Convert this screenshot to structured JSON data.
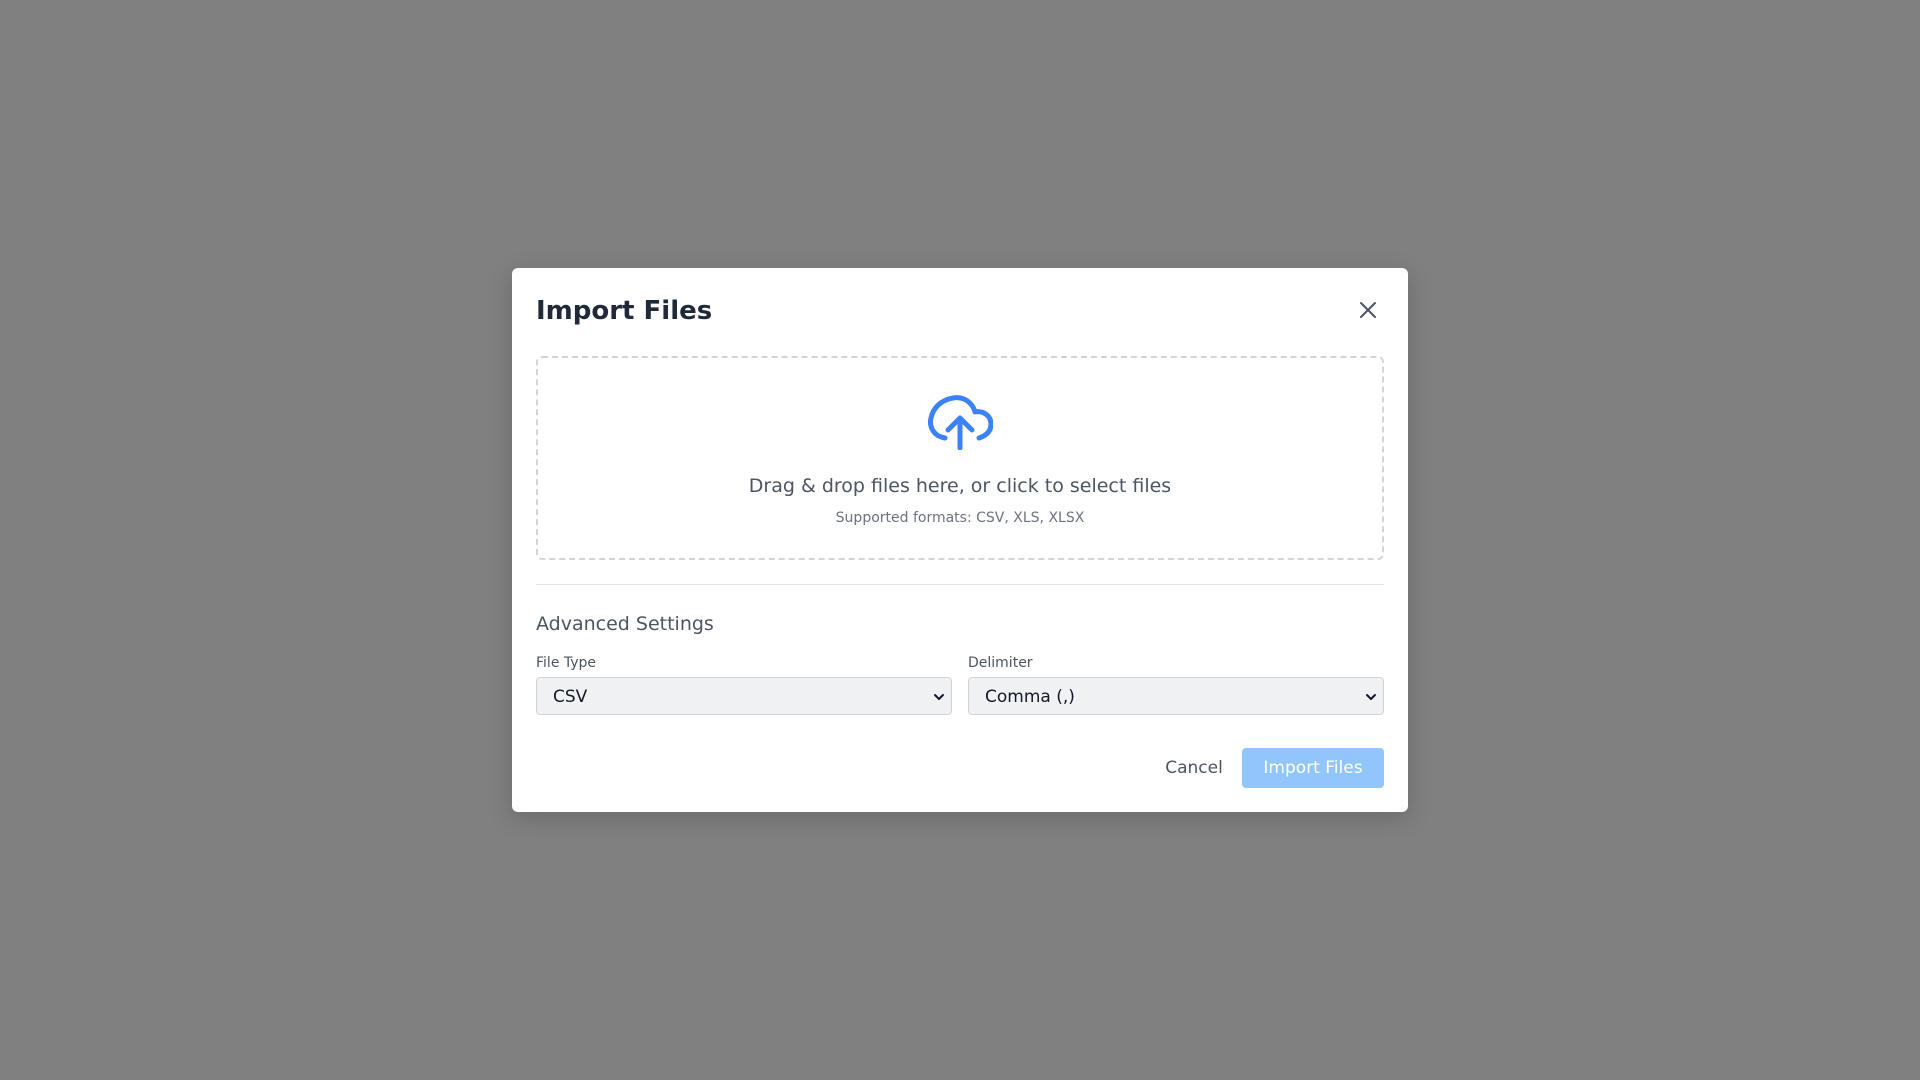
{
  "modal": {
    "title": "Import Files",
    "close_icon": "close-icon"
  },
  "dropzone": {
    "icon": "cloud-upload-icon",
    "text": "Drag & drop files here, or click to select files",
    "subtext": "Supported formats: CSV, XLS, XLSX"
  },
  "advanced": {
    "title": "Advanced Settings",
    "file_type": {
      "label": "File Type",
      "value": "CSV"
    },
    "delimiter": {
      "label": "Delimiter",
      "value": "Comma (,)"
    }
  },
  "actions": {
    "cancel_label": "Cancel",
    "import_label": "Import Files"
  },
  "colors": {
    "overlay": "#808080",
    "accent": "#3b82f6",
    "primary_disabled": "#93c5fd"
  }
}
